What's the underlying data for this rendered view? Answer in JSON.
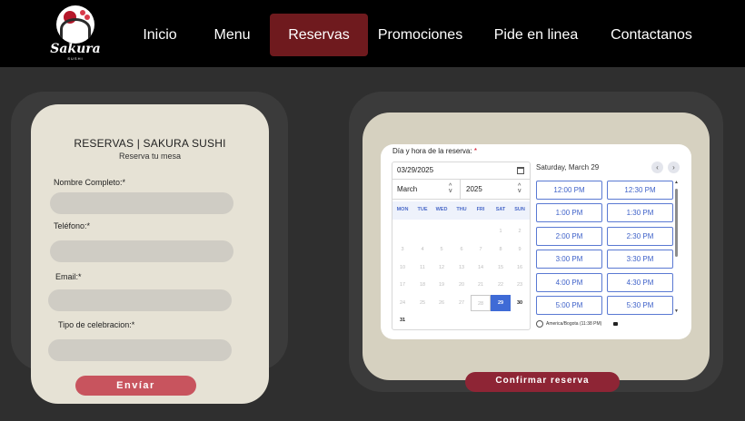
{
  "brand": {
    "name": "Sakura",
    "sub": "SUSHI"
  },
  "nav": {
    "items": [
      {
        "label": "Inicio"
      },
      {
        "label": "Menu"
      },
      {
        "label": "Reservas",
        "active": true
      },
      {
        "label": "Promociones"
      },
      {
        "label": "Pide en linea"
      },
      {
        "label": "Contactanos"
      }
    ]
  },
  "form": {
    "title": "RESERVAS | SAKURA SUSHI",
    "subtitle": "Reserva tu mesa",
    "fields": [
      {
        "label": "Nombre Completo:*",
        "value": ""
      },
      {
        "label": "Teléfono:*",
        "value": ""
      },
      {
        "label": "Email:*",
        "value": ""
      },
      {
        "label": "Tipo de celebracion:*",
        "value": ""
      }
    ],
    "submit_label": "Envíar"
  },
  "booking": {
    "label": "Día y hora de la reserva:",
    "required_mark": "*",
    "date_value": "03/29/2025",
    "month": "March",
    "year": "2025",
    "weekdays": [
      "MON",
      "TUE",
      "WED",
      "THU",
      "FRI",
      "SAT",
      "SUN"
    ],
    "weeks": [
      [
        "",
        "",
        "",
        "",
        "",
        "1",
        "2"
      ],
      [
        "3",
        "4",
        "5",
        "6",
        "7",
        "8",
        "9"
      ],
      [
        "10",
        "11",
        "12",
        "13",
        "14",
        "15",
        "16"
      ],
      [
        "17",
        "18",
        "19",
        "20",
        "21",
        "22",
        "23"
      ],
      [
        "24",
        "25",
        "26",
        "27",
        "28",
        "29",
        "30"
      ],
      [
        "31",
        "",
        "",
        "",
        "",
        "",
        ""
      ]
    ],
    "selected_day": "29",
    "outlined_day": "28",
    "available_days": [
      "29",
      "30",
      "31"
    ],
    "slot_date": "Saturday, March 29",
    "slots": [
      [
        "12:00 PM",
        "12:30 PM"
      ],
      [
        "1:00 PM",
        "1:30 PM"
      ],
      [
        "2:00 PM",
        "2:30 PM"
      ],
      [
        "3:00 PM",
        "3:30 PM"
      ],
      [
        "4:00 PM",
        "4:30 PM"
      ],
      [
        "5:00 PM",
        "5:30 PM"
      ]
    ],
    "timezone": "America/Bogota (11:38 PM)",
    "confirm_label": "Confirmar reserva"
  },
  "colors": {
    "nav_bg": "#000000",
    "active_tab": "#6f1a1e",
    "page_bg": "#2f2f2f",
    "form_card": "#e6e2d5",
    "submit": "#c8545e",
    "confirm": "#8e2535",
    "accent_blue": "#3f6bd6"
  }
}
